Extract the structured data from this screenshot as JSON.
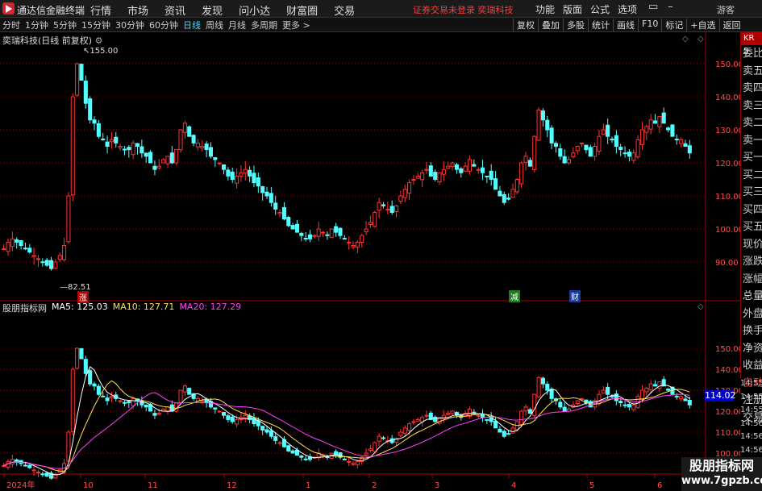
{
  "app": {
    "title": "通达信金融终端"
  },
  "menu": [
    "行情",
    "市场",
    "资讯",
    "发现",
    "问小达",
    "财富圈",
    "交易"
  ],
  "notice": "证券交易未登录 奕瑞科技",
  "right_menu": [
    "功能",
    "版面",
    "公式",
    "选项"
  ],
  "guest": "游客",
  "periods": [
    "分时",
    "1分钟",
    "5分钟",
    "15分钟",
    "30分钟",
    "60分钟",
    "日线",
    "周线",
    "月线",
    "多周期",
    "更多 >"
  ],
  "active_period": "日线",
  "toolbar_buttons": [
    "复权",
    "叠加",
    "多股",
    "统计",
    "画线",
    "F10",
    "标记",
    "+自选",
    "返回"
  ],
  "price_panel": {
    "title": "奕瑞科技(日线 前复权)",
    "high_label": "155.00",
    "low_label": "82.51"
  },
  "indicator_panel": {
    "name": "股朋指标网",
    "ma5": "MA5: 125.03",
    "ma10": "MA10: 127.71",
    "ma20": "MA20: 127.29"
  },
  "sidebar": {
    "kr": "KR 5",
    "items": [
      "委比",
      "卖五",
      "卖四",
      "卖三",
      "卖二",
      "卖一",
      "买一",
      "买二",
      "买三",
      "买四",
      "买五",
      "现价",
      "涨跌",
      "涨幅",
      "总量",
      "外盘",
      "换手",
      "净资",
      "收益"
    ],
    "auto": "自动",
    "extra": [
      "注册",
      "交易"
    ]
  },
  "times": [
    "14:55",
    "14:55",
    "14:55",
    "14:56",
    "14:56",
    "14:56",
    "14:56",
    "14:56"
  ],
  "markers": {
    "zhang": "涨",
    "jian": "减",
    "cai": "财"
  },
  "current_price": "114.02",
  "watermark": {
    "cn": "股朋指标网",
    "url": "www.7gpzb.com"
  },
  "x_labels": [
    "2024年",
    "10",
    "11",
    "12",
    "1",
    "2",
    "3",
    "4",
    "5",
    "6"
  ],
  "colors": {
    "up": "#ff3232",
    "down": "#54ffff",
    "grid": "#8b0000",
    "axis": "#b00000",
    "ma5": "#ffffff",
    "ma10": "#ffe24a",
    "ma20": "#ff40ff"
  },
  "chart_data": {
    "type": "candlestick",
    "y_ticks_top": [
      90,
      100,
      110,
      120,
      130,
      140,
      150
    ],
    "y_ticks_bottom": [
      100,
      110,
      120,
      130,
      140,
      150
    ],
    "close_series": [
      94,
      96,
      97,
      96,
      95,
      94,
      93,
      92,
      91,
      90,
      89,
      88,
      90,
      92,
      95,
      110,
      140,
      150,
      145,
      138,
      133,
      132,
      128,
      127,
      125,
      127,
      126,
      125,
      124,
      124,
      126,
      125,
      123,
      122,
      120,
      118,
      119,
      121,
      122,
      120,
      124,
      130,
      132,
      128,
      126,
      126,
      125,
      124,
      122,
      121,
      120,
      118,
      116,
      115,
      116,
      117,
      118,
      116,
      114,
      113,
      111,
      110,
      108,
      106,
      105,
      103,
      101,
      100,
      99,
      98,
      97,
      97,
      98,
      100,
      99,
      98,
      100,
      99,
      98,
      97,
      96,
      95,
      96,
      98,
      100,
      102,
      105,
      108,
      107,
      106,
      105,
      107,
      110,
      112,
      114,
      115,
      116,
      117,
      118,
      116,
      115,
      117,
      118,
      119,
      120,
      118,
      117,
      119,
      121,
      119,
      118,
      117,
      116,
      115,
      112,
      110,
      108,
      109,
      112,
      115,
      120,
      122,
      119,
      128,
      136,
      133,
      130,
      126,
      125,
      122,
      120,
      121,
      123,
      125,
      126,
      124,
      122,
      125,
      128,
      130,
      128,
      127,
      125,
      124,
      123,
      122,
      123,
      127,
      130,
      131,
      133,
      132,
      134,
      132,
      130,
      128,
      127,
      127,
      125,
      123
    ]
  }
}
